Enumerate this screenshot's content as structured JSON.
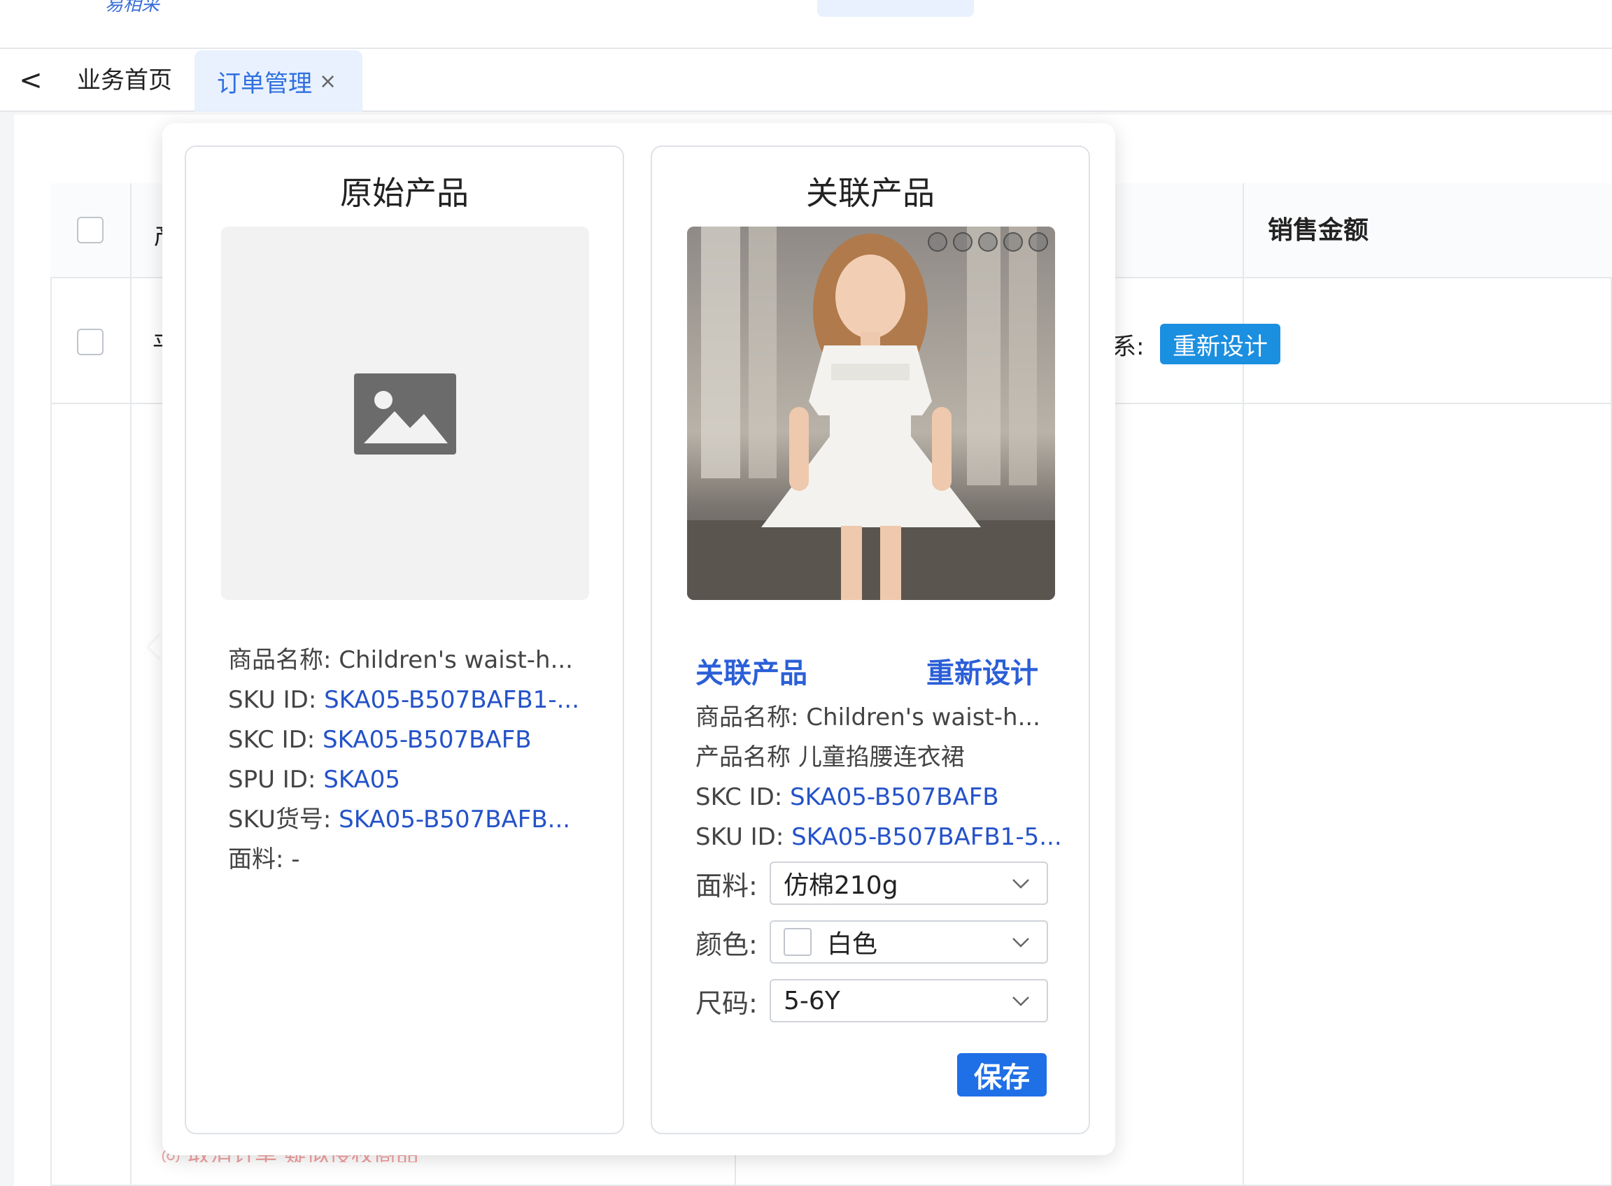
{
  "header": {
    "logo_text": "易相采"
  },
  "tabs": {
    "home_label": "业务首页",
    "active_label": "订单管理",
    "close_symbol": "×",
    "back_symbol": "<"
  },
  "table": {
    "sales_amount_header": "销售金额",
    "row_fragment_left_head": "产",
    "row_fragment_left": "平",
    "row_fragment_mid": "系:",
    "redesign_badge": "重新设计",
    "red_text": "◎ 取消订单  疑似侵权商品"
  },
  "original": {
    "title": "原始产品",
    "image_icon": "image-placeholder-icon",
    "name_label": "商品名称:",
    "name_value": "Children's waist-h...",
    "sku_label": "SKU ID:",
    "sku_value": "SKA05-B507BAFB1-...",
    "skc_label": "SKC ID:",
    "skc_value": "SKA05-B507BAFB",
    "spu_label": "SPU ID:",
    "spu_value": "SKA05",
    "skuno_label": "SKU货号:",
    "skuno_value": "SKA05-B507BAFB...",
    "fabric_label": "面料:",
    "fabric_value": "-"
  },
  "related": {
    "title": "关联产品",
    "link_related": "关联产品",
    "link_redesign": "重新设计",
    "name_label": "商品名称:",
    "name_value": "Children's waist-h...",
    "product_name_label": "产品名称",
    "product_name_value": "儿童掐腰连衣裙",
    "skc_label": "SKC ID:",
    "skc_value": "SKA05-B507BAFB",
    "sku_label": "SKU ID:",
    "sku_value": "SKA05-B507BAFB1-5...",
    "fabric_label": "面料:",
    "fabric_value": "仿棉210g",
    "color_label": "颜色:",
    "color_value": "白色",
    "size_label": "尺码:",
    "size_value": "5-6Y",
    "save_label": "保存",
    "image_dot_count": 5
  },
  "colors": {
    "accent": "#1f6fe6",
    "link": "#2452c8",
    "badge": "#1b8fe0",
    "tab_active_bg": "#e8f1fd"
  }
}
